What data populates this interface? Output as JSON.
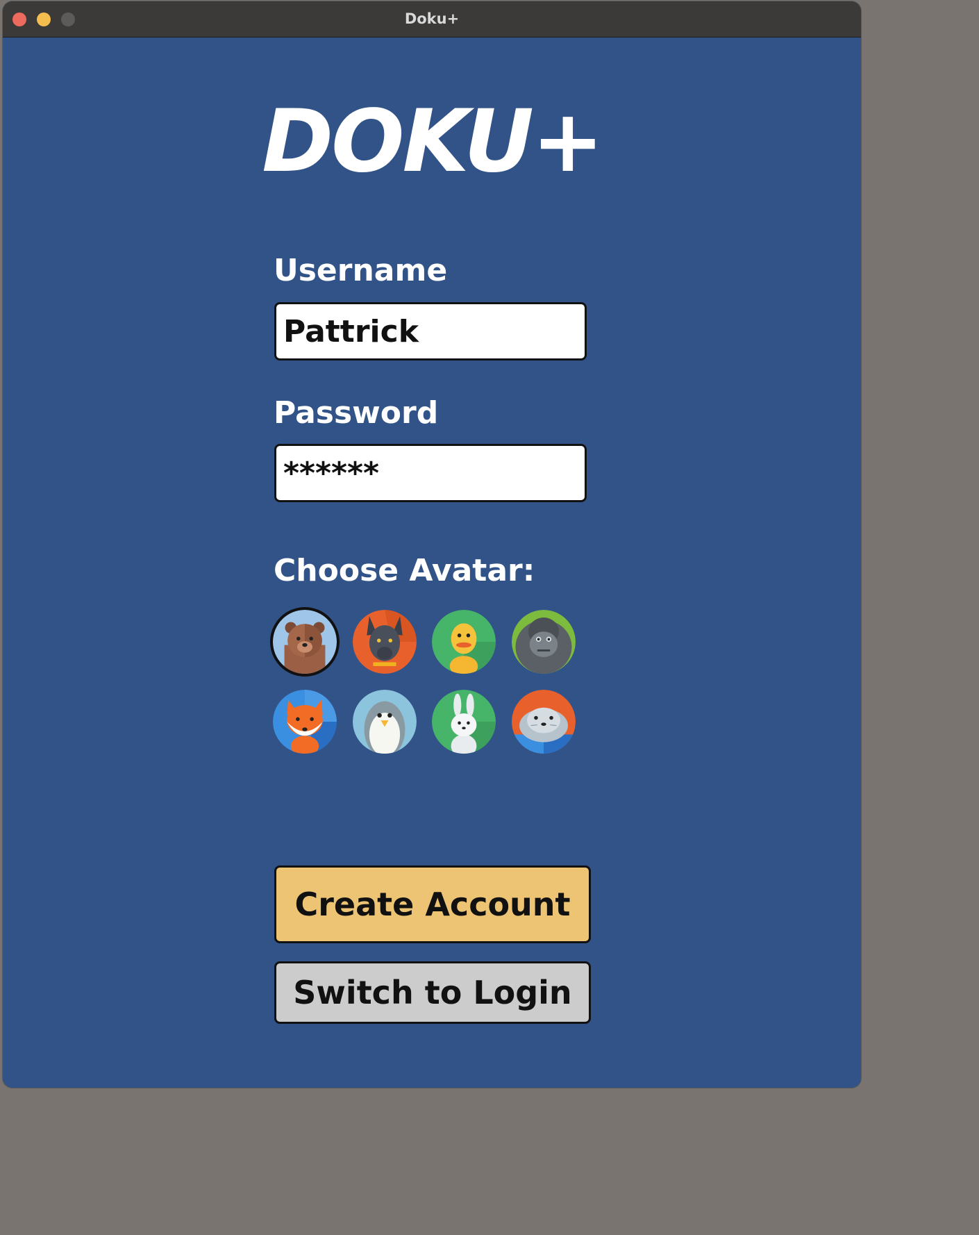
{
  "window": {
    "title": "Doku+"
  },
  "logo": "DOKU+",
  "form": {
    "username_label": "Username",
    "username_value": "Pattrick",
    "password_label": "Password",
    "password_value": "******",
    "avatar_label": "Choose Avatar:"
  },
  "avatars": [
    {
      "icon": "bear-icon",
      "selected": true
    },
    {
      "icon": "dog-icon",
      "selected": false
    },
    {
      "icon": "duck-icon",
      "selected": false
    },
    {
      "icon": "gorilla-icon",
      "selected": false
    },
    {
      "icon": "fox-icon",
      "selected": false
    },
    {
      "icon": "penguin-icon",
      "selected": false
    },
    {
      "icon": "rabbit-icon",
      "selected": false
    },
    {
      "icon": "seal-icon",
      "selected": false
    }
  ],
  "buttons": {
    "create_account": "Create Account",
    "switch_to_login": "Switch to Login"
  },
  "colors": {
    "background": "#325388",
    "create_button": "#ecc473",
    "switch_button": "#cccccc"
  }
}
